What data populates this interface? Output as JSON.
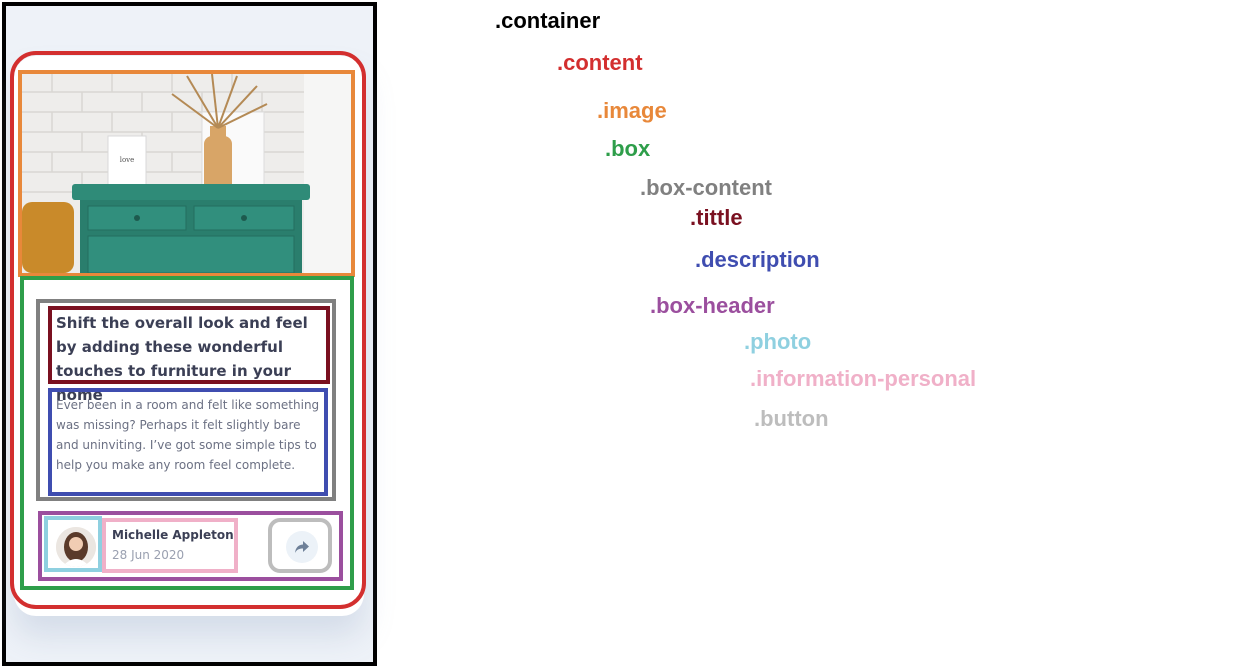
{
  "card": {
    "title": "Shift the overall look and feel by adding these wonderful touches to furniture in your home",
    "description": "Ever been in a room and felt like something was missing? Perhaps it felt slightly bare and uninviting. I’ve got some simple tips to help you make any room feel complete.",
    "author_name": "Michelle Appleton",
    "date": "28 Jun 2020",
    "share_icon": "share-arrow-icon"
  },
  "labels": {
    "container": ".container",
    "content": ".content",
    "image": ".image",
    "box": ".box",
    "box_content": ".box-content",
    "tittle": ".tittle",
    "description": ".description",
    "box_header": ".box-header",
    "photo": ".photo",
    "information_personal": ".information-personal",
    "button": ".button"
  },
  "colors": {
    "container": "#000000",
    "content": "#d32f2f",
    "image": "#e8883a",
    "box": "#2e9e4a",
    "box_content": "#808080",
    "tittle": "#7a1020",
    "description": "#3f4db0",
    "box_header": "#9b4f9e",
    "photo": "#8fd0e0",
    "information_personal": "#f0b0c8",
    "button": "#bdbdbd"
  }
}
